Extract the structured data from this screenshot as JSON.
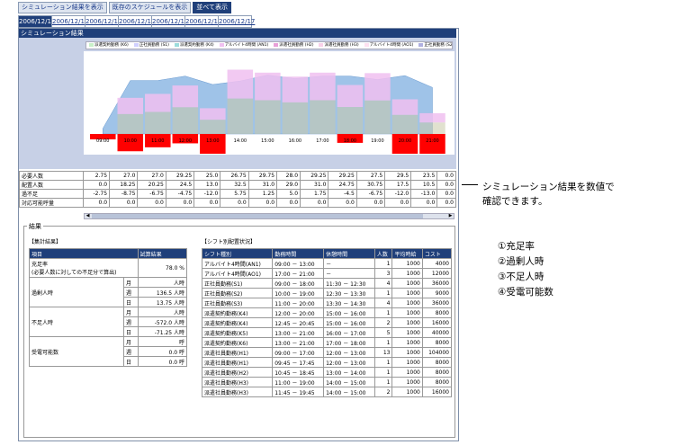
{
  "top_buttons": [
    "シミュレーション結果を表示",
    "既存のスケジュールを表示",
    "並べて表示"
  ],
  "date_tabs": [
    "2006/12/11",
    "2006/12/12",
    "2006/12/13",
    "2006/12/14",
    "2006/12/15",
    "2006/12/16",
    "2006/12/17"
  ],
  "sim_title": "シミュレーション結果",
  "legend": [
    {
      "label": "派遣契約勤務 (K6)",
      "color": "#c8f0c8"
    },
    {
      "label": "正社員勤務 (S1)",
      "color": "#d0d0ff"
    },
    {
      "label": "派遣契約勤務 (K4)",
      "color": "#9cdcdc"
    },
    {
      "label": "アルバイト4時間 (AN1)",
      "color": "#f0c0f0"
    },
    {
      "label": "派遣社員勤務 (H2)",
      "color": "#e8a0d8"
    },
    {
      "label": "派遣社員勤務 (H3)",
      "color": "#f8d0e8"
    },
    {
      "label": "アルバイト4時間 (AO1)",
      "color": "#ffe0f0"
    },
    {
      "label": "正社員勤務 (S2)",
      "color": "#b0b0e0"
    }
  ],
  "time_labels": [
    "09:00",
    "10:00",
    "11:00",
    "12:00",
    "13:00",
    "14:00",
    "15:00",
    "16:00",
    "17:00",
    "18:00",
    "19:00",
    "20:00",
    "21:00"
  ],
  "data_rows": [
    {
      "label": "必要人数",
      "values": [
        "2.75",
        "27.0",
        "27.0",
        "29.25",
        "25.0",
        "26.75",
        "29.75",
        "28.0",
        "29.25",
        "29.25",
        "27.5",
        "29.5",
        "23.5",
        "0.0"
      ]
    },
    {
      "label": "配置人数",
      "values": [
        "0.0",
        "18.25",
        "20.25",
        "24.5",
        "13.0",
        "32.5",
        "31.0",
        "29.0",
        "31.0",
        "24.75",
        "30.75",
        "17.5",
        "10.5",
        "0.0"
      ]
    },
    {
      "label": "過不足",
      "values": [
        "-2.75",
        "-8.75",
        "-6.75",
        "-4.75",
        "-12.0",
        "5.75",
        "1.25",
        "5.0",
        "1.75",
        "-4.5",
        "-6.75",
        "-12.0",
        "-13.0",
        "0.0"
      ]
    },
    {
      "label": "対応可能呼量",
      "values": [
        "0.0",
        "0.0",
        "0.0",
        "0.0",
        "0.0",
        "0.0",
        "0.0",
        "0.0",
        "0.0",
        "0.0",
        "0.0",
        "0.0",
        "0.0",
        "0.0"
      ]
    }
  ],
  "result_title": "結果",
  "summary_title": "【集計結果】",
  "summary_headers": [
    "項目",
    "試算結果"
  ],
  "fill_rate": {
    "label": "充足率",
    "sub": "(必要人数に対しての不足分で算出)",
    "value": "78.0 %"
  },
  "over_time": {
    "label": "過剰人時",
    "rows": [
      [
        "月",
        "人時"
      ],
      [
        "週",
        "136.5 人時"
      ],
      [
        "日",
        "13.75 人時"
      ]
    ]
  },
  "short_time": {
    "label": "不足人時",
    "rows": [
      [
        "月",
        "人時"
      ],
      [
        "週",
        "-572.0 人時"
      ],
      [
        "日",
        "-71.25 人時"
      ]
    ]
  },
  "call_volume": {
    "label": "受電可能数",
    "rows": [
      [
        "月",
        "呼"
      ],
      [
        "週",
        "0.0 呼"
      ],
      [
        "日",
        "0.0 呼"
      ]
    ]
  },
  "shift_title": "【シフト別配置状況】",
  "shift_headers": [
    "シフト種別",
    "勤務時間",
    "休憩時間",
    "人数",
    "平均時給",
    "コスト"
  ],
  "shifts": [
    [
      "アルバイト4時間(AN1)",
      "09:00 － 13:00",
      "－",
      "1",
      "1000",
      "4000"
    ],
    [
      "アルバイト4時間(AO1)",
      "17:00 － 21:00",
      "－",
      "3",
      "1000",
      "12000"
    ],
    [
      "正社員勤務(S1)",
      "09:00 － 18:00",
      "11:30 － 12:30",
      "4",
      "1000",
      "36000"
    ],
    [
      "正社員勤務(S2)",
      "10:00 － 19:00",
      "12:30 － 13:30",
      "1",
      "1000",
      "9000"
    ],
    [
      "正社員勤務(S3)",
      "11:00 － 20:00",
      "13:30 － 14:30",
      "4",
      "1000",
      "36000"
    ],
    [
      "派遣契約勤務(K4)",
      "12:00 － 20:00",
      "15:00 － 16:00",
      "1",
      "1000",
      "8000"
    ],
    [
      "派遣契約勤務(K4)",
      "12:45 － 20:45",
      "15:00 － 16:00",
      "2",
      "1000",
      "16000"
    ],
    [
      "派遣契約勤務(K5)",
      "13:00 － 21:00",
      "16:00 － 17:00",
      "5",
      "1000",
      "40000"
    ],
    [
      "派遣契約勤務(K6)",
      "13:00 － 21:00",
      "17:00 － 18:00",
      "1",
      "1000",
      "8000"
    ],
    [
      "派遣社員勤務(H1)",
      "09:00 － 17:00",
      "12:00 － 13:00",
      "13",
      "1000",
      "104000"
    ],
    [
      "派遣社員勤務(H1)",
      "09:45 － 17:45",
      "12:00 － 13:00",
      "1",
      "1000",
      "8000"
    ],
    [
      "派遣社員勤務(H2)",
      "10:45 － 18:45",
      "13:00 － 14:00",
      "1",
      "1000",
      "8000"
    ],
    [
      "派遣社員勤務(H3)",
      "11:00 － 19:00",
      "14:00 － 15:00",
      "1",
      "1000",
      "8000"
    ],
    [
      "派遣社員勤務(H3)",
      "11:45 － 19:45",
      "14:00 － 15:00",
      "2",
      "1000",
      "16000"
    ]
  ],
  "annotation": {
    "text_line1": "シミュレーション結果を数値で",
    "text_line2": "確認できます。",
    "items": [
      "①充足率",
      "②過剰人時",
      "③不足人時",
      "④受電可能数"
    ]
  },
  "chart_data": {
    "type": "area",
    "categories": [
      "09:00",
      "10:00",
      "11:00",
      "12:00",
      "13:00",
      "14:00",
      "15:00",
      "16:00",
      "17:00",
      "18:00",
      "19:00",
      "20:00",
      "21:00"
    ],
    "required": [
      2.75,
      27.0,
      27.0,
      29.25,
      25.0,
      26.75,
      29.75,
      28.0,
      29.25,
      29.25,
      27.5,
      29.5,
      23.5
    ],
    "assigned": [
      0.0,
      18.25,
      20.25,
      24.5,
      13.0,
      32.5,
      31.0,
      29.0,
      31.0,
      24.75,
      30.75,
      17.5,
      10.5
    ],
    "colors": {
      "required": "#9fc3e8",
      "shortage": "#ff0000",
      "assigned_top": "#f0c0f0",
      "assigned_base": "#c8c8a8"
    }
  }
}
